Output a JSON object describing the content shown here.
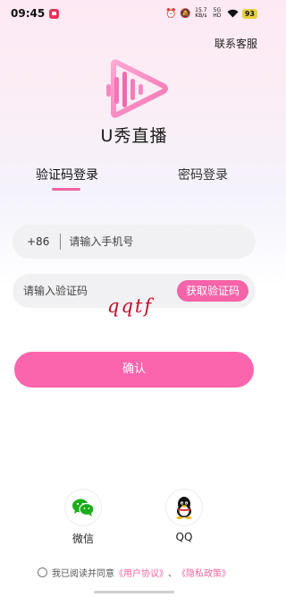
{
  "status_bar": {
    "time": "09:45",
    "net_speed": "15.7\nKB/s",
    "net_type": "5G\nHD",
    "battery": "93"
  },
  "header": {
    "contact_label": "联系客服"
  },
  "app": {
    "name": "U秀直播"
  },
  "tabs": [
    {
      "label": "验证码登录",
      "active": true
    },
    {
      "label": "密码登录",
      "active": false
    }
  ],
  "phone_field": {
    "country_code": "+86",
    "placeholder": "请输入手机号"
  },
  "code_field": {
    "placeholder": "请输入验证码",
    "get_code_label": "获取验证码"
  },
  "captcha": {
    "text": "qqtf"
  },
  "confirm": {
    "label": "确认"
  },
  "social": {
    "wechat_label": "微信",
    "qq_label": "QQ"
  },
  "agreement": {
    "prefix": "我已阅读并同意",
    "user_agreement": "《用户协议》",
    "separator": "、",
    "privacy_policy": "《隐私政策》"
  },
  "colors": {
    "accent": "#fb65ae",
    "tab_indicator": "#f064a3",
    "captcha": "#c0102b"
  }
}
